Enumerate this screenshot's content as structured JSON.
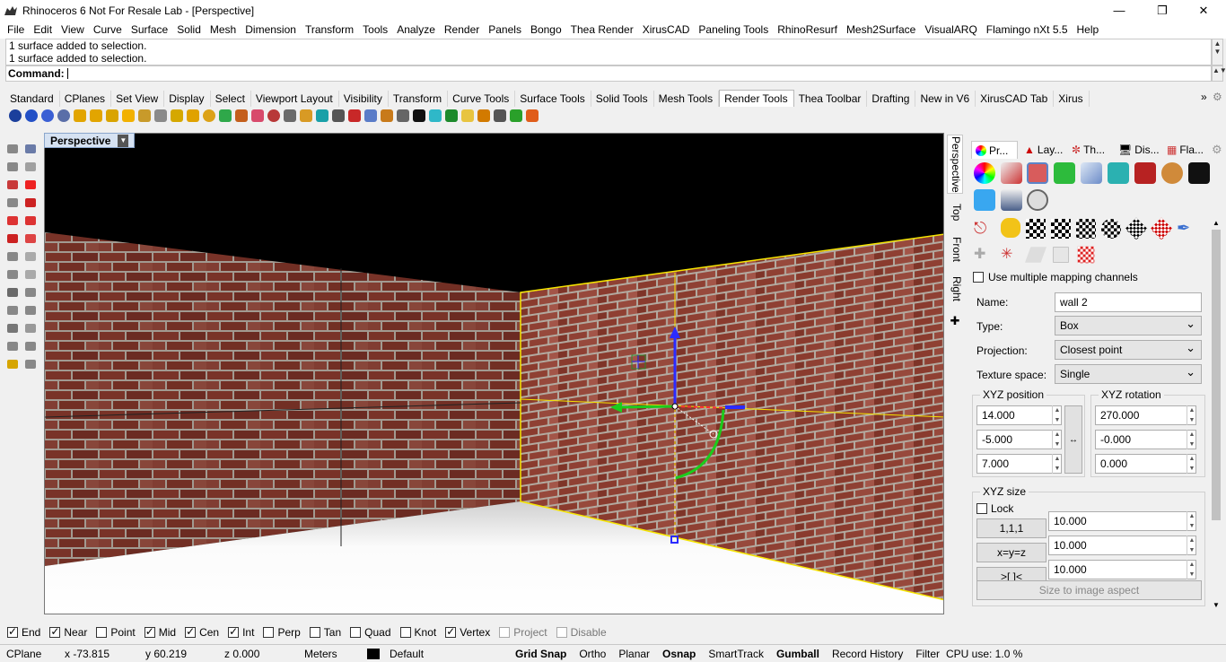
{
  "window": {
    "title": "Rhinoceros 6 Not For Resale Lab - [Perspective]",
    "minimize_icon": "—",
    "maximize_icon": "❐",
    "close_icon": "✕"
  },
  "menu": [
    "File",
    "Edit",
    "View",
    "Curve",
    "Surface",
    "Solid",
    "Mesh",
    "Dimension",
    "Transform",
    "Tools",
    "Analyze",
    "Render",
    "Panels",
    "Bongo",
    "Thea Render",
    "XirusCAD",
    "Paneling Tools",
    "RhinoResurf",
    "Mesh2Surface",
    "VisualARQ",
    "Flamingo nXt 5.5",
    "Help"
  ],
  "history": [
    "1 surface added to selection.",
    "1 surface added to selection."
  ],
  "command": {
    "label": "Command:",
    "value": ""
  },
  "toolbar_tabs": [
    "Standard",
    "CPlanes",
    "Set View",
    "Display",
    "Select",
    "Viewport Layout",
    "Visibility",
    "Transform",
    "Curve Tools",
    "Surface Tools",
    "Solid Tools",
    "Mesh Tools",
    "Render Tools",
    "Thea Toolbar",
    "Drafting",
    "New in V6",
    "XirusCAD Tab",
    "Xirus"
  ],
  "active_toolbar_tab": "Render Tools",
  "viewport": {
    "name": "Perspective",
    "side_tabs": [
      "Perspective",
      "Top",
      "Front",
      "Right"
    ],
    "colors": {
      "background": "#000000",
      "brick": "#8a3b2e",
      "mortar": "#b9b0a6",
      "selection": "#f5e400"
    }
  },
  "panel": {
    "tabs": [
      "Pr...",
      "Lay...",
      "Th...",
      "Dis...",
      "Fla..."
    ],
    "multiple_mapping_label": "Use multiple mapping channels",
    "multiple_mapping_checked": false,
    "name_label": "Name:",
    "name_value": "wall 2",
    "type_label": "Type:",
    "type_value": "Box",
    "projection_label": "Projection:",
    "projection_value": "Closest point",
    "texture_space_label": "Texture space:",
    "texture_space_value": "Single",
    "xyz_position_label": "XYZ position",
    "xyz_position": [
      "14.000",
      "-5.000",
      "7.000"
    ],
    "xyz_rotation_label": "XYZ rotation",
    "xyz_rotation": [
      "270.000",
      "-0.000",
      "0.000"
    ],
    "xyz_size_label": "XYZ size",
    "lock_label": "Lock",
    "lock_checked": false,
    "size_buttons": [
      "1,1,1",
      "x=y=z",
      ">[ ]<"
    ],
    "xyz_size": [
      "10.000",
      "10.000",
      "10.000"
    ],
    "size_to_image_label": "Size to image aspect"
  },
  "osnap": [
    {
      "label": "End",
      "checked": true
    },
    {
      "label": "Near",
      "checked": true
    },
    {
      "label": "Point",
      "checked": false
    },
    {
      "label": "Mid",
      "checked": true
    },
    {
      "label": "Cen",
      "checked": true
    },
    {
      "label": "Int",
      "checked": true
    },
    {
      "label": "Perp",
      "checked": false
    },
    {
      "label": "Tan",
      "checked": false
    },
    {
      "label": "Quad",
      "checked": false
    },
    {
      "label": "Knot",
      "checked": false
    },
    {
      "label": "Vertex",
      "checked": true
    },
    {
      "label": "Project",
      "checked": false,
      "disabled": true
    },
    {
      "label": "Disable",
      "checked": false,
      "disabled": true
    }
  ],
  "status": {
    "cplane": "CPlane",
    "x": "x -73.815",
    "y": "y 60.219",
    "z": "z 0.000",
    "units": "Meters",
    "layer": "Default",
    "grid_snap": "Grid Snap",
    "ortho": "Ortho",
    "planar": "Planar",
    "osnap": "Osnap",
    "smarttrack": "SmartTrack",
    "gumball": "Gumball",
    "record_history": "Record History",
    "filter": "Filter",
    "cpu": "CPU use: 1.0 %"
  }
}
